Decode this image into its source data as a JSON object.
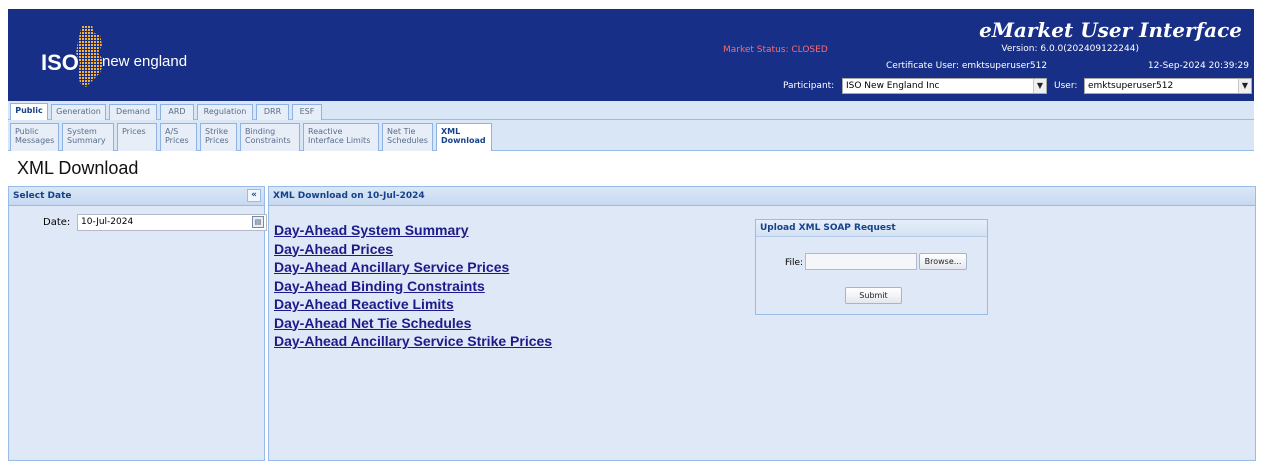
{
  "header": {
    "logo_left": "ISO",
    "logo_right": "new england",
    "app_title": "eMarket User Interface",
    "market_status": "Market Status: CLOSED",
    "version": "Version: 6.0.0(202409122244)",
    "certificate_user": "Certificate User: emktsuperuser512",
    "datetime": "12-Sep-2024 20:39:29",
    "participant_label": "Participant:",
    "participant_value": "ISO New England Inc",
    "user_label": "User:",
    "user_value": "emktsuperuser512",
    "colors": {
      "background": "#172f86",
      "status": "#ff6a6a"
    }
  },
  "tabs_level1": [
    "Public",
    "Generation",
    "Demand",
    "ARD",
    "Regulation",
    "DRR",
    "ESF"
  ],
  "tabs_level2": [
    {
      "line1": "Public",
      "line2": "Messages"
    },
    {
      "line1": "System",
      "line2": "Summary"
    },
    {
      "line1": "Prices",
      "line2": ""
    },
    {
      "line1": "A/S",
      "line2": "Prices"
    },
    {
      "line1": "Strike",
      "line2": "Prices"
    },
    {
      "line1": "Binding",
      "line2": "Constraints"
    },
    {
      "line1": "Reactive",
      "line2": "Interface Limits"
    },
    {
      "line1": "Net Tie",
      "line2": "Schedules"
    },
    {
      "line1": "XML",
      "line2": "Download"
    }
  ],
  "page_title": "XML Download",
  "left_panel": {
    "title": "Select Date",
    "collapse_glyph": "«",
    "date_label": "Date:",
    "date_value": "10-Jul-2024"
  },
  "main_panel": {
    "title": "XML Download on 10-Jul-2024",
    "links": [
      "Day-Ahead System Summary",
      "Day-Ahead Prices",
      "Day-Ahead Ancillary Service Prices",
      "Day-Ahead Binding Constraints",
      "Day-Ahead Reactive Limits",
      "Day-Ahead Net Tie Schedules",
      "Day-Ahead Ancillary Service Strike Prices"
    ],
    "upload": {
      "title": "Upload XML SOAP Request",
      "file_label": "File:",
      "file_value": "",
      "browse_label": "Browse...",
      "submit_label": "Submit"
    }
  }
}
